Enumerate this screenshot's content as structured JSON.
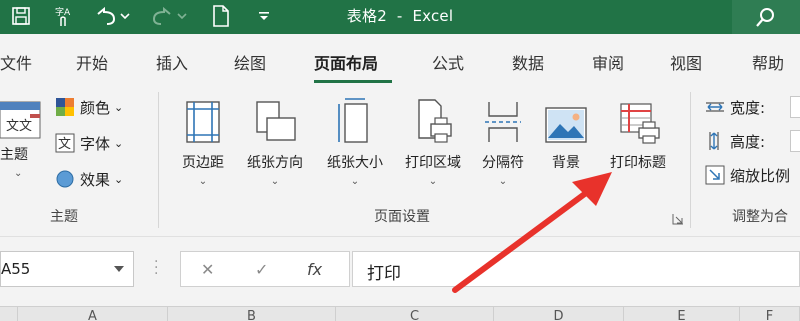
{
  "window": {
    "title": "表格2",
    "separator": "-",
    "app_name": "Excel",
    "accent_color": "#217346",
    "quick_access": [
      "save-icon",
      "touch-mode-icon",
      "undo-icon",
      "redo-icon",
      "new-file-icon",
      "customize-icon"
    ]
  },
  "tabs": [
    {
      "label": "文件"
    },
    {
      "label": "开始"
    },
    {
      "label": "插入"
    },
    {
      "label": "绘图"
    },
    {
      "label": "页面布局",
      "active": true
    },
    {
      "label": "公式"
    },
    {
      "label": "数据"
    },
    {
      "label": "审阅"
    },
    {
      "label": "视图"
    },
    {
      "label": "帮助"
    }
  ],
  "ribbon": {
    "themes_group": {
      "label": "主题",
      "themes_button": "主题",
      "colors": "颜色",
      "fonts": "字体",
      "effects": "效果"
    },
    "page_setup_group": {
      "label": "页面设置",
      "buttons": [
        {
          "label": "页边距",
          "icon": "margins-icon"
        },
        {
          "label": "纸张方向",
          "icon": "orientation-icon"
        },
        {
          "label": "纸张大小",
          "icon": "size-icon"
        },
        {
          "label": "打印区域",
          "icon": "print-area-icon"
        },
        {
          "label": "分隔符",
          "icon": "breaks-icon"
        },
        {
          "label": "背景",
          "icon": "background-icon"
        },
        {
          "label": "打印标题",
          "icon": "print-titles-icon"
        }
      ]
    },
    "scale_group": {
      "label": "调整为合",
      "width": "宽度:",
      "height": "高度:",
      "scale": "缩放比例"
    }
  },
  "formula_bar": {
    "name_box": "A55",
    "cancel": "✕",
    "enter": "✓",
    "fx": "fx",
    "content": "打印"
  },
  "columns": [
    "A",
    "B",
    "C",
    "D",
    "E",
    "F"
  ],
  "annotation": {
    "arrow_color": "#e8322b"
  }
}
